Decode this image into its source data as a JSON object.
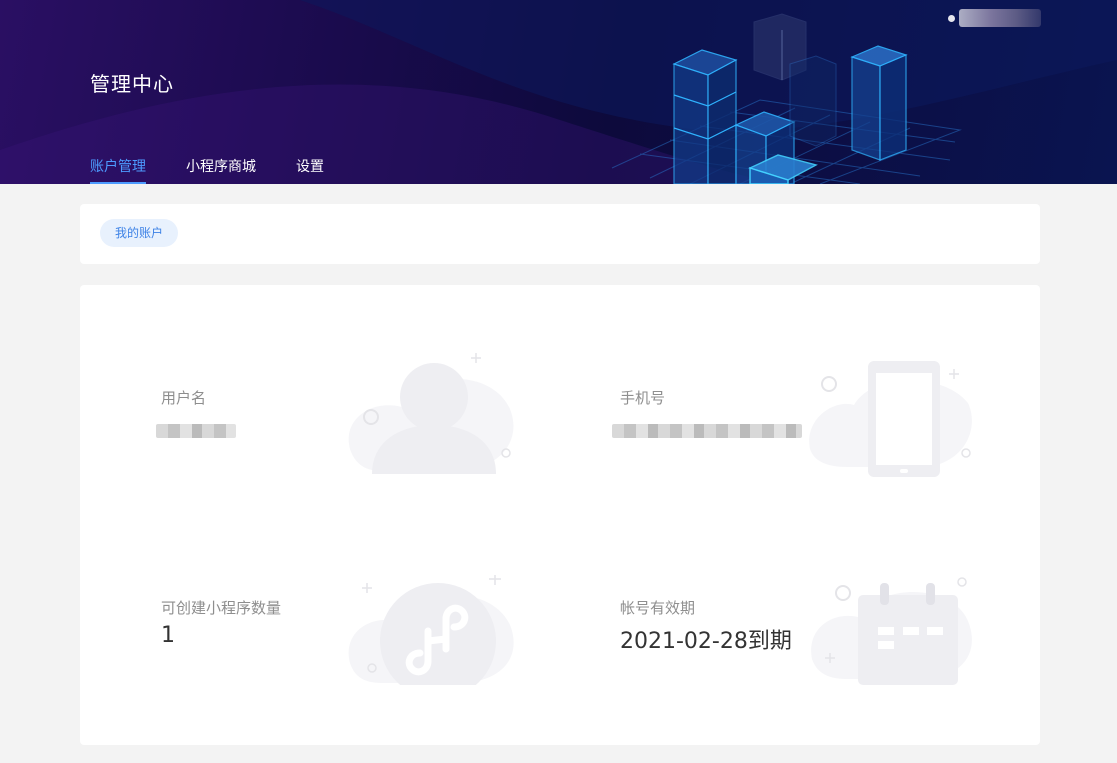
{
  "header": {
    "title": "管理中心",
    "tabs": [
      {
        "label": "账户管理",
        "active": true
      },
      {
        "label": "小程序商城",
        "active": false
      },
      {
        "label": "设置",
        "active": false
      }
    ],
    "user": {
      "name": "用户"
    }
  },
  "breadcrumb": {
    "chip_label": "我的账户"
  },
  "account": {
    "username_label": "用户名",
    "username_value": "用户",
    "phone_label": "手机号",
    "phone_value": "15",
    "miniprogram_count_label": "可创建小程序数量",
    "miniprogram_count_value": "1",
    "validity_label": "帐号有效期",
    "validity_value": "2021-02-28到期"
  },
  "colors": {
    "accent": "#4d9bff",
    "chip_bg": "#e8f1fd",
    "chip_text": "#3d82e6",
    "illustration": "#eeeef2"
  }
}
